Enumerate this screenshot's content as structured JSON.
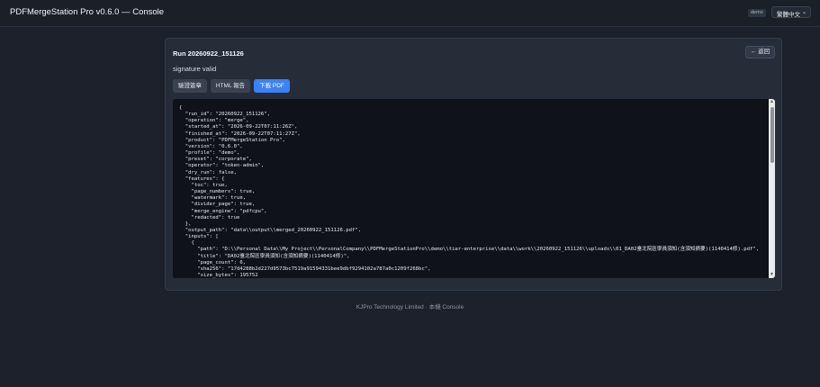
{
  "header": {
    "title": "PDFMergeStation Pro v0.6.0 — Console",
    "badge": "demo",
    "language": "繁體中文"
  },
  "run": {
    "title": "Run 20260922_151126",
    "back_label": "← 返回",
    "signature_status": "signature valid",
    "buttons": {
      "verify": "驗證簽章",
      "html_report": "HTML 報告",
      "download_pdf": "下載 PDF"
    },
    "json_text": "{\n  \"run_id\": \"20260922_151126\",\n  \"operation\": \"merge\",\n  \"started_at\": \"2026-09-22T07:11:26Z\",\n  \"finished_at\": \"2026-09-22T07:11:27Z\",\n  \"product\": \"PDFMergeStation Pro\",\n  \"version\": \"0.6.0\",\n  \"profile\": \"demo\",\n  \"preset\": \"corporate\",\n  \"operator\": \"token-admin\",\n  \"dry_run\": false,\n  \"features\": {\n    \"toc\": true,\n    \"page_numbers\": true,\n    \"watermark\": true,\n    \"divider_page\": true,\n    \"merge_engine\": \"pdfcpu\",\n    \"redacted\": true\n  },\n  \"output_path\": \"data\\\\output\\\\merged_20260922_151126.pdf\",\n  \"inputs\": [\n    {\n      \"path\": \"D:\\\\Personal Data\\\\My Project\\\\PersonalCompany\\\\PDFMergeStationPro\\\\demo\\\\tier-enterprise\\\\data\\\\work\\\\20260922_151126\\\\uploads\\\\01_DA02臺北院區學員須知(含須知摘要)(1140414修).pdf\",\n      \"title\": \"DA02臺北院區學員須知(含須知摘要)(1140414修)\",\n      \"page_count\": 6,\n      \"sha256\": \"17d4288b2d227d9573bc7519a91594331bee9dbf9294102a787a0c1209f268bc\",\n      \"size_bytes\": 195752"
  },
  "footer": {
    "text": "KJPro Technology Limited · 本機 Console"
  }
}
